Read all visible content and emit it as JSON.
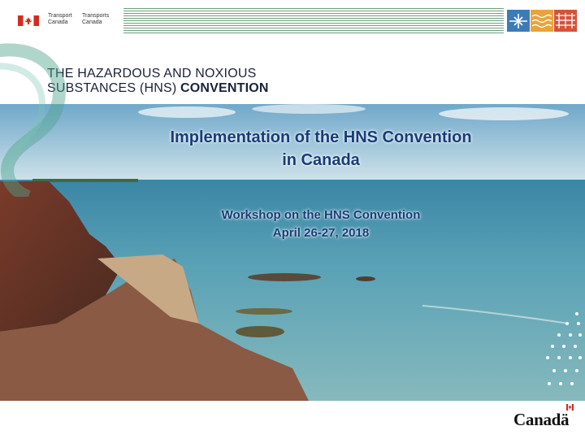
{
  "header": {
    "dept_en": [
      "Transport",
      "Canada"
    ],
    "dept_fr": [
      "Transports",
      "Canada"
    ],
    "flag_icon": "canada-flag-icon",
    "mode_icons": [
      "aviation-icon",
      "marine-icon",
      "rail-icon"
    ]
  },
  "convention_title": {
    "line1": "THE HAZARDOUS AND NOXIOUS",
    "line2_regular": "SUBSTANCES (HNS) ",
    "line2_bold": "CONVENTION"
  },
  "slide": {
    "title_line1": "Implementation of the HNS Convention",
    "title_line2": "in Canada",
    "subtitle_line1": "Workshop on the HNS Convention",
    "subtitle_line2": "April 26-27, 2018"
  },
  "footer": {
    "wordmark": "Canadä"
  },
  "colors": {
    "title_text": "#173c78",
    "stripe_green": "#6f9f7f",
    "flag_red": "#d52b1e"
  }
}
